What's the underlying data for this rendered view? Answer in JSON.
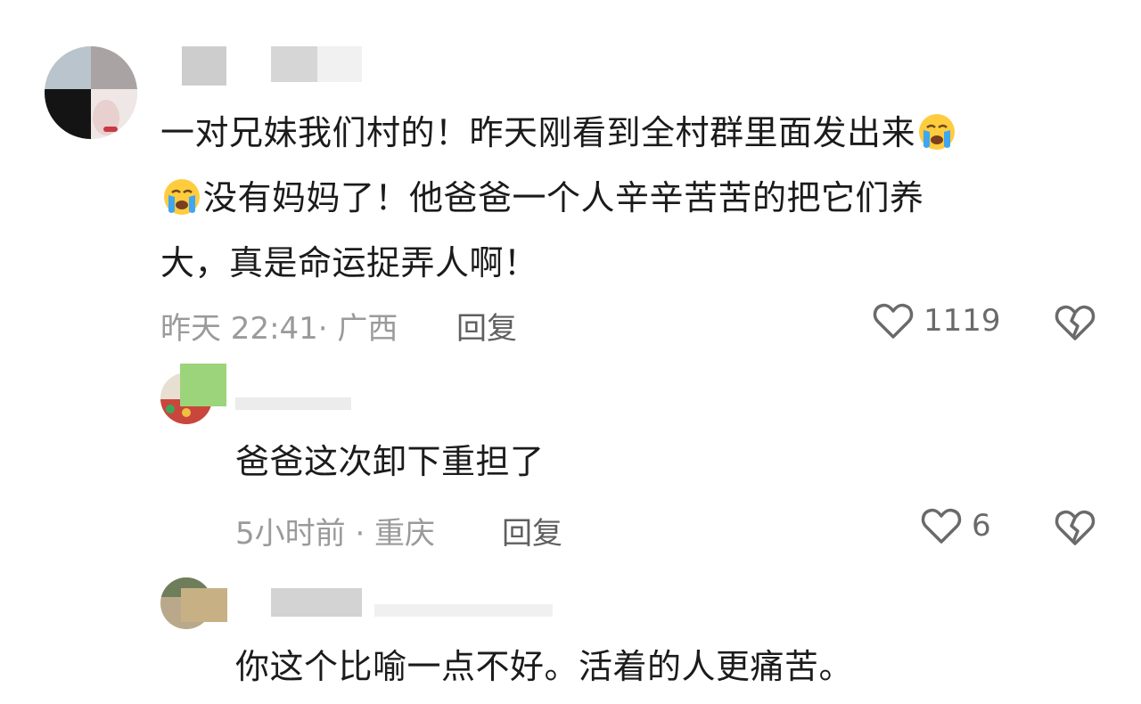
{
  "comments": [
    {
      "text_line1": "一对兄妹我们村的！昨天刚看到全村群里面发出来",
      "text_line2": "没有妈妈了！他爸爸一个人辛辛苦苦的把它们养",
      "text_line3": "大，真是命运捉弄人啊！",
      "emoji": "loudly-crying-face",
      "meta": "昨天 22:41· 广西",
      "reply_label": "回复",
      "likes": "1119"
    },
    {
      "text": "爸爸这次卸下重担了",
      "meta": "5小时前 · 重庆",
      "reply_label": "回复",
      "likes": "6"
    },
    {
      "text": "你这个比喻一点不好。活着的人更痛苦。"
    }
  ],
  "colors": {
    "text": "#1b1b1b",
    "meta": "#9a9a9a",
    "reply": "#5f5f5f",
    "icon": "#6a6a6a"
  }
}
